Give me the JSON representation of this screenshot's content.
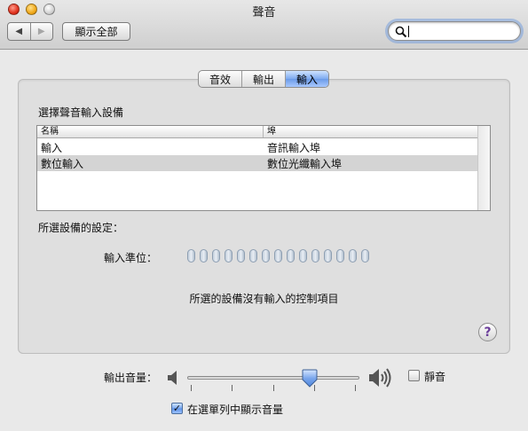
{
  "window": {
    "title": "聲音",
    "nav_back": "◀",
    "nav_forward": "▶",
    "show_all_label": "顯示全部",
    "search": {
      "value": "",
      "placeholder": ""
    }
  },
  "tabs": [
    {
      "label": "音效",
      "active": false
    },
    {
      "label": "輸出",
      "active": false
    },
    {
      "label": "輸入",
      "active": true
    }
  ],
  "input_panel": {
    "select_device_label": "選擇聲音輸入設備",
    "table": {
      "columns": [
        "名稱",
        "埠"
      ],
      "rows": [
        {
          "name": "輸入",
          "port": "音訊輸入埠",
          "selected": false
        },
        {
          "name": "數位輸入",
          "port": "數位光纖輸入埠",
          "selected": true
        }
      ]
    },
    "settings_label": "所選設備的設定：",
    "input_level_label": "輸入準位：",
    "input_level_segments": 15,
    "input_level_lit": 0,
    "no_controls_message": "所選的設備沒有輸入的控制項目",
    "help_label": "?"
  },
  "output_volume": {
    "label": "輸出音量：",
    "level_percent": 71,
    "mute_label": "靜音",
    "mute_checked": false,
    "show_in_menubar_label": "在選單列中顯示音量",
    "show_in_menubar_checked": true
  },
  "colors": {
    "accent": "#6b9be8",
    "selection_row": "#d4d4d4",
    "help_glyph": "#6a3d9a"
  }
}
